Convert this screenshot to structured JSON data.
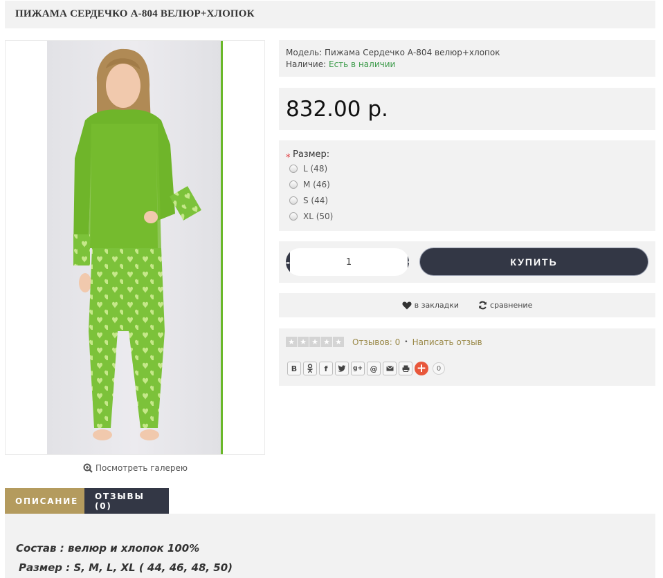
{
  "product": {
    "title": "ПИЖАМА СЕРДЕЧКО А-804 ВЕЛЮР+ХЛОПОК",
    "model_label": "Модель:",
    "model_value": "Пижама Сердечко А-804 велюр+хлопок",
    "stock_label": "Наличие:",
    "stock_value": "Есть в наличии",
    "price": "832.00 р."
  },
  "gallery": {
    "link_label": "Посмотреть галерею"
  },
  "options": {
    "required_mark": "*",
    "size_label": "Размер:",
    "sizes": [
      "L (48)",
      "M (46)",
      "S (44)",
      "XL (50)"
    ]
  },
  "cart": {
    "minus": "-",
    "plus": "+",
    "quantity": "1",
    "buy_label": "КУПИТЬ"
  },
  "actions": {
    "wishlist": "в закладки",
    "compare": "сравнение"
  },
  "reviews": {
    "count_label": "Отзывов: 0",
    "separator": "•",
    "write_label": "Написать отзыв",
    "rating": 0,
    "max_rating": 5
  },
  "share": {
    "buttons": [
      "В",
      "ok",
      "f",
      "tw",
      "g+",
      "@",
      "mail",
      "print"
    ],
    "count": "0"
  },
  "tabs": {
    "description": "ОПИСАНИЕ",
    "reviews": "ОТЗЫВЫ (0)"
  },
  "description": {
    "line1": "Состав : велюр и хлопок 100%",
    "line2": "Размер : S, M, L, XL ( 44, 46, 48, 50)"
  },
  "colors": {
    "accent_gold": "#b49b5e",
    "dark_button": "#333745",
    "in_stock": "#3a9a48",
    "review_link": "#9b8a4a",
    "required": "#e0383c",
    "share_plus": "#e8573b"
  }
}
